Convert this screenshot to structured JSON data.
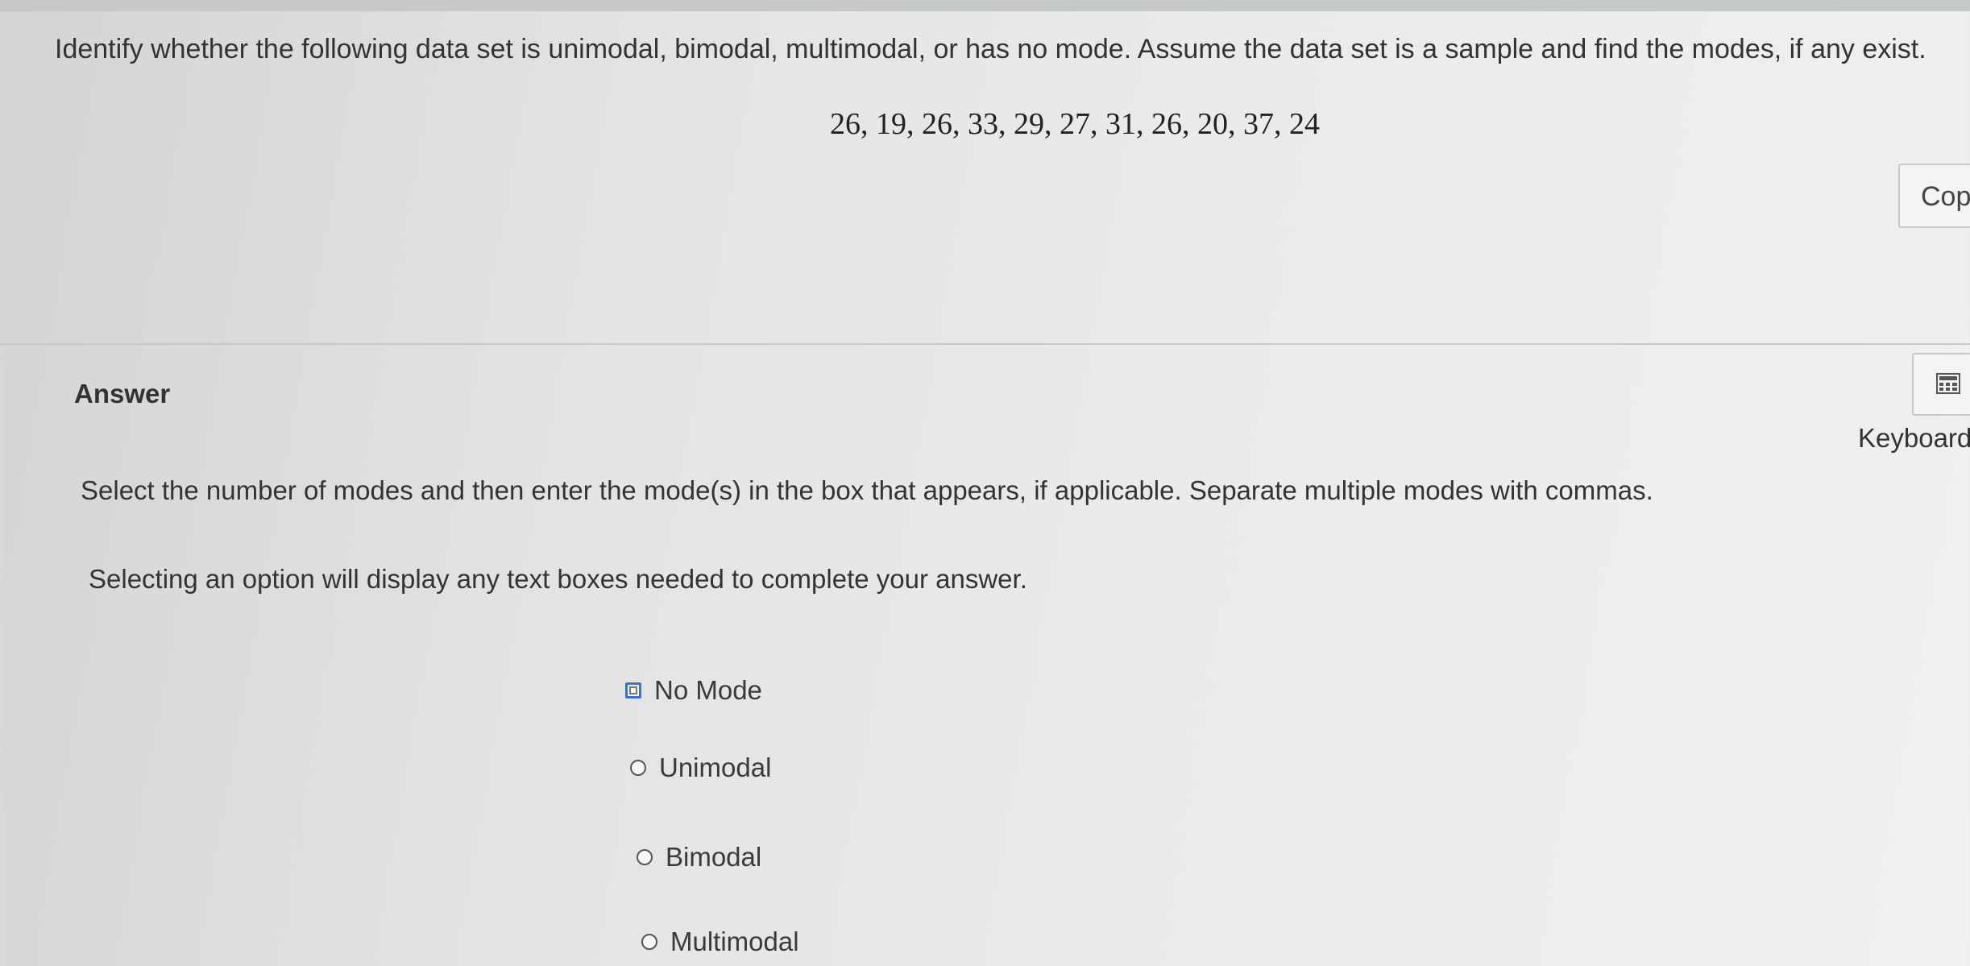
{
  "question": {
    "prompt": "Identify whether the following data set is unimodal, bimodal, multimodal, or has no mode. Assume the data set is a sample and find the modes, if any exist.",
    "data_set": "26, 19, 26, 33, 29, 27, 31, 26, 20, 37, 24",
    "copy_label": "Copy"
  },
  "answer": {
    "heading": "Answer",
    "keyboard_label": "Keyboard",
    "keyboard_icon": "keyboard-icon",
    "instruction": "Select the number of modes and then enter the mode(s) in the box that appears, if applicable. Separate multiple modes with commas.",
    "hint": "Selecting an option will display any text boxes needed to complete your answer.",
    "options": [
      {
        "label": "No Mode",
        "selected": false,
        "focused": true
      },
      {
        "label": "Unimodal",
        "selected": false
      },
      {
        "label": "Bimodal",
        "selected": false
      },
      {
        "label": "Multimodal",
        "selected": false
      }
    ]
  }
}
